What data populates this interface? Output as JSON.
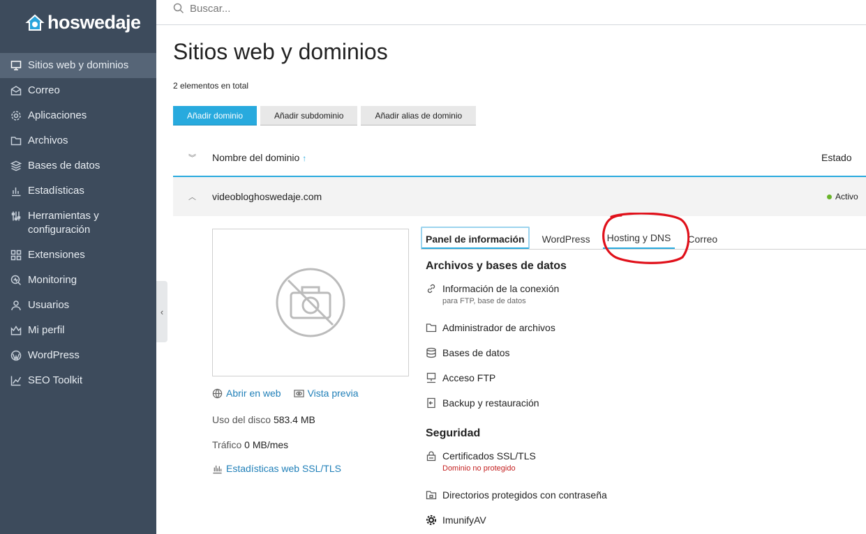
{
  "brand": {
    "name": "hoswedaje"
  },
  "search": {
    "placeholder": "Buscar..."
  },
  "sidebar": {
    "items": [
      {
        "label": "Sitios web y dominios",
        "icon": "monitor-icon"
      },
      {
        "label": "Correo",
        "icon": "mail-icon"
      },
      {
        "label": "Aplicaciones",
        "icon": "gear-icon"
      },
      {
        "label": "Archivos",
        "icon": "folder-icon"
      },
      {
        "label": "Bases de datos",
        "icon": "database-icon"
      },
      {
        "label": "Estadísticas",
        "icon": "bar-chart-icon"
      },
      {
        "label": "Herramientas y configuración",
        "icon": "tools-icon"
      },
      {
        "label": "Extensiones",
        "icon": "extensions-icon"
      },
      {
        "label": "Monitoring",
        "icon": "monitoring-icon"
      },
      {
        "label": "Usuarios",
        "icon": "user-icon"
      },
      {
        "label": "Mi perfil",
        "icon": "profile-icon"
      },
      {
        "label": "WordPress",
        "icon": "wordpress-icon"
      },
      {
        "label": "SEO Toolkit",
        "icon": "seo-icon"
      }
    ],
    "active_index": 0
  },
  "page": {
    "title": "Sitios web y dominios",
    "total": "2 elementos en total"
  },
  "actions": {
    "add_domain": "Añadir dominio",
    "add_subdomain": "Añadir subdominio",
    "add_alias": "Añadir alias de dominio"
  },
  "list": {
    "col_domain": "Nombre del dominio",
    "sort_arrow": "↑",
    "col_status": "Estado"
  },
  "domain": {
    "name": "videobloghoswedaje.com",
    "status": "Activo",
    "status_color": "#69b42a"
  },
  "preview": {
    "open_web": "Abrir en web",
    "preview": "Vista previa",
    "disk_label": "Uso del disco",
    "disk_value": "583.4 MB",
    "traffic_label": "Tráfico",
    "traffic_value": "0 MB/mes",
    "stats_link": "Estadísticas web SSL/TLS"
  },
  "tabs": [
    {
      "label": "Panel de información",
      "active": true
    },
    {
      "label": "WordPress",
      "active": false
    },
    {
      "label": "Hosting y DNS",
      "active": false
    },
    {
      "label": "Correo",
      "active": false
    }
  ],
  "sections": {
    "files": {
      "title": "Archivos y bases de datos",
      "tools": [
        {
          "label": "Información de la conexión",
          "sub": "para FTP, base de datos",
          "icon": "link-icon"
        },
        {
          "label": "Administrador de archivos",
          "icon": "folder-icon"
        },
        {
          "label": "Bases de datos",
          "icon": "database-icon"
        },
        {
          "label": "Acceso FTP",
          "icon": "ftp-icon"
        },
        {
          "label": "Backup y restauración",
          "icon": "backup-icon"
        }
      ]
    },
    "security": {
      "title": "Seguridad",
      "tools": [
        {
          "label": "Certificados SSL/TLS",
          "sub": "Dominio no protegido",
          "icon": "certificate-icon"
        },
        {
          "label": "Directorios protegidos con contraseña",
          "icon": "protected-folder-icon"
        },
        {
          "label": "ImunifyAV",
          "icon": "shield-gear-icon"
        }
      ]
    }
  },
  "colors": {
    "sidebar": "#3d4b5c",
    "sidebar_active": "#566577",
    "accent": "#28aade",
    "link": "#1f7fb8",
    "warning": "#c42020",
    "annotation": "#e0101a"
  }
}
